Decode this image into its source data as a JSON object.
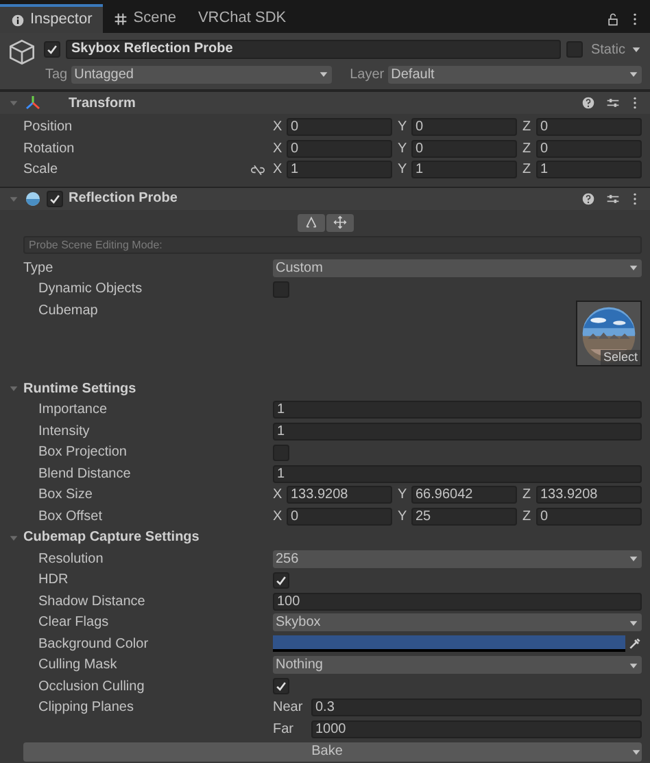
{
  "tabs": [
    {
      "label": "Inspector",
      "selected": true
    },
    {
      "label": "Scene",
      "selected": false
    },
    {
      "label": "VRChat SDK",
      "selected": false
    }
  ],
  "object": {
    "active": true,
    "name": "Skybox Reflection Probe",
    "static": false,
    "static_label": "Static",
    "tag_label": "Tag",
    "tag": "Untagged",
    "layer_label": "Layer",
    "layer": "Default"
  },
  "components": [
    {
      "title": "Transform",
      "expanded": true,
      "rows": [
        {
          "kind": "vector",
          "label": "Position",
          "values": [
            {
              "axis": "X",
              "value": "0"
            },
            {
              "axis": "Y",
              "value": "0"
            },
            {
              "axis": "Z",
              "value": "0"
            }
          ]
        },
        {
          "kind": "vector",
          "label": "Rotation",
          "values": [
            {
              "axis": "X",
              "value": "0"
            },
            {
              "axis": "Y",
              "value": "0"
            },
            {
              "axis": "Z",
              "value": "0"
            }
          ]
        },
        {
          "kind": "vector",
          "label": "Scale",
          "linked": false,
          "values": [
            {
              "axis": "X",
              "value": "1"
            },
            {
              "axis": "Y",
              "value": "1"
            },
            {
              "axis": "Z",
              "value": "1"
            }
          ]
        }
      ]
    },
    {
      "title": "Reflection Probe",
      "enabled": true,
      "expanded": true,
      "rows": [
        {
          "kind": "edit_modes"
        },
        {
          "kind": "note",
          "text": "Probe Scene Editing Mode:"
        },
        {
          "kind": "dropdown",
          "label": "Type",
          "value": "Custom",
          "children": [
            {
              "kind": "checkbox",
              "label": "Dynamic Objects",
              "checked": false
            },
            {
              "kind": "cubemap",
              "label": "Cubemap",
              "button": "Select"
            }
          ]
        },
        {
          "kind": "section",
          "label": "Runtime Settings",
          "expanded": true,
          "children": [
            {
              "kind": "text",
              "label": "Importance",
              "value": "1"
            },
            {
              "kind": "text",
              "label": "Intensity",
              "value": "1"
            },
            {
              "kind": "checkbox",
              "label": "Box Projection",
              "checked": false
            },
            {
              "kind": "text",
              "label": "Blend Distance",
              "value": "1"
            },
            {
              "kind": "vector",
              "label": "Box Size",
              "values": [
                {
                  "axis": "X",
                  "value": "133.9208"
                },
                {
                  "axis": "Y",
                  "value": "66.96042"
                },
                {
                  "axis": "Z",
                  "value": "133.9208"
                }
              ]
            },
            {
              "kind": "vector",
              "label": "Box Offset",
              "values": [
                {
                  "axis": "X",
                  "value": "0"
                },
                {
                  "axis": "Y",
                  "value": "25"
                },
                {
                  "axis": "Z",
                  "value": "0"
                }
              ]
            }
          ]
        },
        {
          "kind": "section",
          "label": "Cubemap Capture Settings",
          "expanded": true,
          "children": [
            {
              "kind": "dropdown",
              "label": "Resolution",
              "value": "256"
            },
            {
              "kind": "checkbox",
              "label": "HDR",
              "checked": true
            },
            {
              "kind": "text",
              "label": "Shadow Distance",
              "value": "100"
            },
            {
              "kind": "dropdown",
              "label": "Clear Flags",
              "value": "Skybox"
            },
            {
              "kind": "color",
              "label": "Background Color",
              "color": "#30538a"
            },
            {
              "kind": "dropdown",
              "label": "Culling Mask",
              "value": "Nothing"
            },
            {
              "kind": "checkbox",
              "label": "Occlusion Culling",
              "checked": true
            },
            {
              "kind": "clipping",
              "label": "Clipping Planes",
              "planes": [
                {
                  "label": "Near",
                  "value": "0.3"
                },
                {
                  "label": "Far",
                  "value": "1000"
                }
              ]
            }
          ]
        },
        {
          "kind": "button",
          "label": "Bake"
        }
      ]
    }
  ]
}
